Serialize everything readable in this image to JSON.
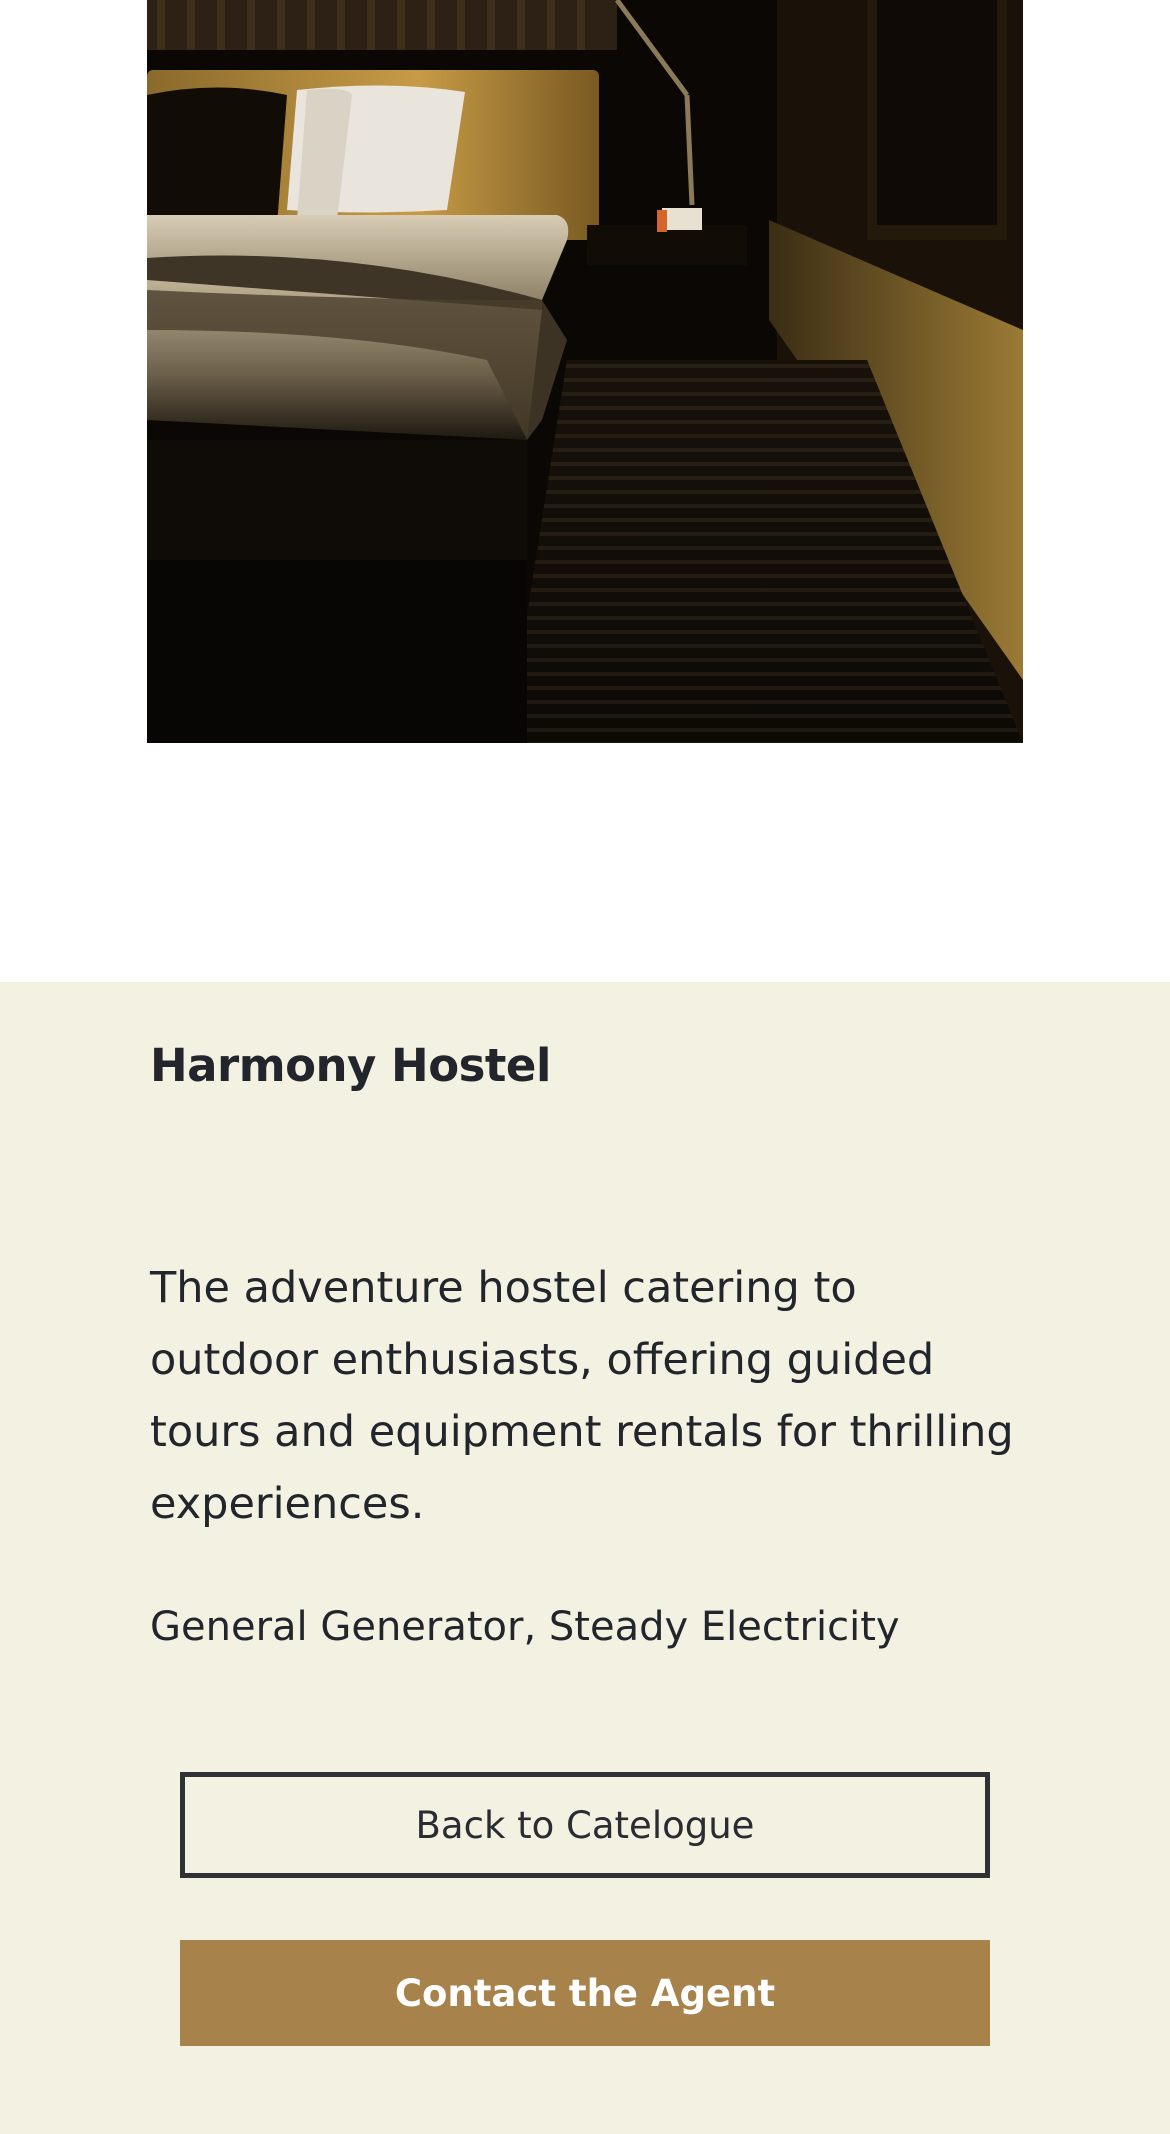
{
  "hero": {
    "image_alt": "Dimly lit hotel room with bed, headboard lamp and striped carpet",
    "icon": "hotel-room-photo"
  },
  "listing": {
    "name": "Harmony Hostel",
    "description": "The adventure hostel catering to outdoor enthusiasts, offering guided tours and equipment rentals for thrilling experiences.",
    "amenities": "General Generator, Steady Electricity"
  },
  "actions": {
    "back_label": "Back to Catelogue",
    "contact_label": "Contact the Agent"
  },
  "colors": {
    "detail_background": "#f3f1e2",
    "accent": "#a8824b",
    "text": "#22252b",
    "button_border": "#2f3135"
  }
}
